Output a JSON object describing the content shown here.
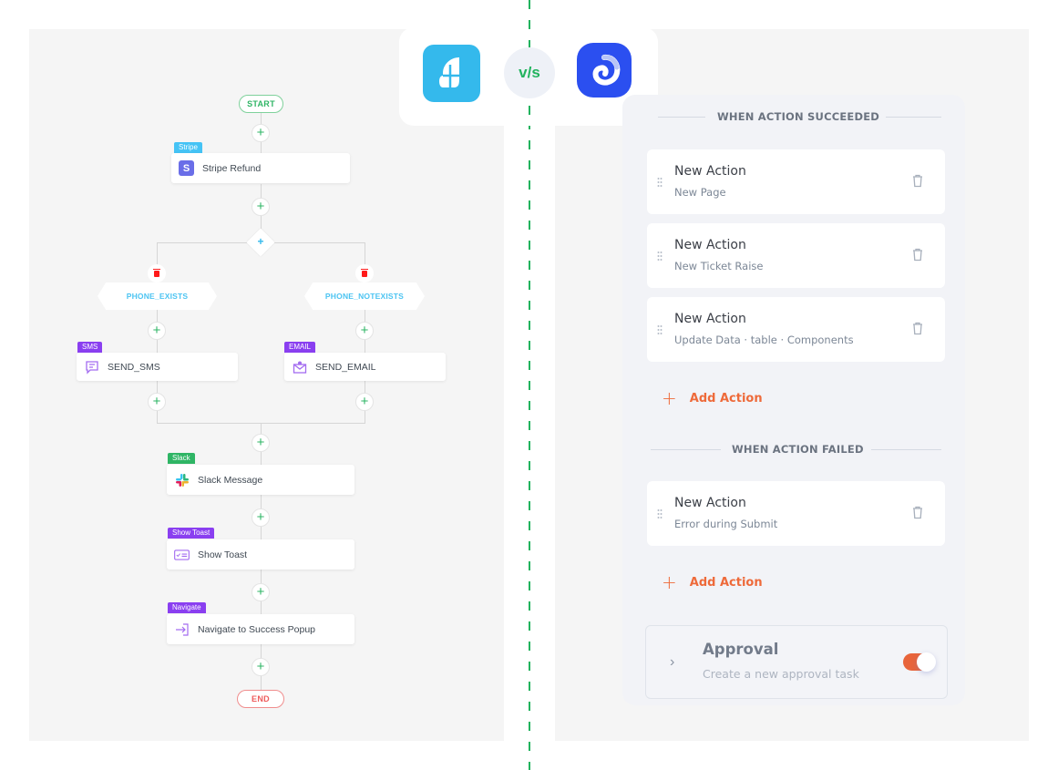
{
  "header": {
    "left_logo": "flowlike-app-logo",
    "vs_label": "v/s",
    "right_logo": "swirl-app-logo",
    "colors": {
      "divider": "#22b35e",
      "left_logo_bg": "#34b9ec",
      "right_logo_bg": "#2b4ff0"
    }
  },
  "workflow": {
    "start_label": "START",
    "end_label": "END",
    "steps": [
      {
        "tag": "Stripe",
        "tag_color": "#45c3f5",
        "label": "Stripe Refund",
        "icon": "stripe-icon"
      }
    ],
    "branches": [
      {
        "condition": "PHONE_EXISTS",
        "step": {
          "tag": "SMS",
          "tag_color": "#8a3ff0",
          "label": "SEND_SMS",
          "icon": "sms-icon"
        }
      },
      {
        "condition": "PHONE_NOTEXISTS",
        "step": {
          "tag": "EMAIL",
          "tag_color": "#8a3ff0",
          "label": "SEND_EMAIL",
          "icon": "email-icon"
        }
      }
    ],
    "after_steps": [
      {
        "tag": "Slack",
        "tag_color": "#2fb565",
        "label": "Slack Message",
        "icon": "slack-icon"
      },
      {
        "tag": "Show Toast",
        "tag_color": "#8a3ff0",
        "label": "Show Toast",
        "icon": "toast-icon"
      },
      {
        "tag": "Navigate",
        "tag_color": "#8a3ff0",
        "label": "Navigate to Success Popup",
        "icon": "navigate-icon"
      }
    ]
  },
  "actions_panel": {
    "succeeded_label": "WHEN ACTION SUCCEEDED",
    "succeeded_actions": [
      {
        "title": "New Action",
        "subtitle": "New Page"
      },
      {
        "title": "New Action",
        "subtitle": "New Ticket Raise"
      },
      {
        "title": "New Action",
        "subtitle": "Update Data · table · Components"
      }
    ],
    "add_action_label": "Add Action",
    "failed_label": "WHEN ACTION FAILED",
    "failed_actions": [
      {
        "title": "New Action",
        "subtitle": "Error during Submit"
      }
    ],
    "approval": {
      "title": "Approval",
      "subtitle": "Create a new approval task",
      "enabled": true
    },
    "colors": {
      "accent": "#ee6a3a",
      "toggle_on": "#e8643a"
    }
  }
}
